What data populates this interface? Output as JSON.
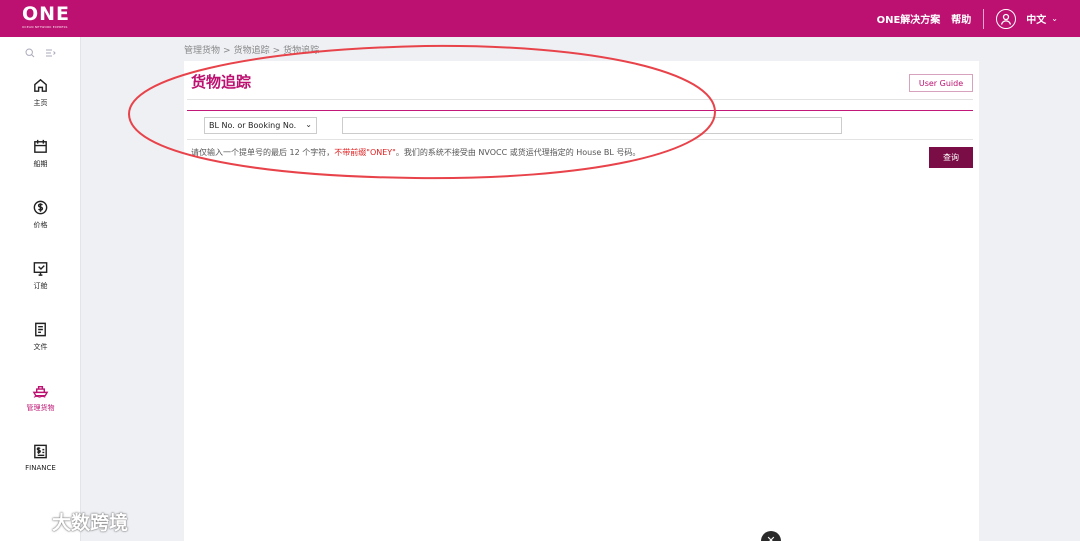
{
  "header": {
    "logo_text": "ONE",
    "logo_subtitle": "OCEAN NETWORK EXPRESS",
    "solutions_link": "ONE解决方案",
    "help_link": "帮助",
    "language": "中文",
    "brand_color": "#bc1170"
  },
  "sidebar": {
    "items": [
      {
        "label": "主页",
        "icon": "home-icon"
      },
      {
        "label": "船期",
        "icon": "calendar-icon"
      },
      {
        "label": "价格",
        "icon": "dollar-icon"
      },
      {
        "label": "订舱",
        "icon": "booking-icon"
      },
      {
        "label": "文件",
        "icon": "document-icon"
      },
      {
        "label": "管理货物",
        "icon": "ship-icon",
        "active": true
      },
      {
        "label": "FINANCE",
        "icon": "finance-icon"
      }
    ]
  },
  "breadcrumb": {
    "items": [
      "管理货物",
      "货物追踪",
      "货物追踪"
    ]
  },
  "main": {
    "title": "货物追踪",
    "user_guide": "User Guide",
    "search_type_selected": "BL No. or Booking No.",
    "bl_input_value": "",
    "hint_prefix": "请仅输入一个提单号的最后 12 个字符，",
    "hint_warning": "不带前缀\"ONEY\"",
    "hint_suffix": "。我们的系统不接受由 NVOCC 或货运代理指定的 House BL 号码。",
    "query_button": "查询"
  },
  "watermark": {
    "text": "大数跨境"
  }
}
